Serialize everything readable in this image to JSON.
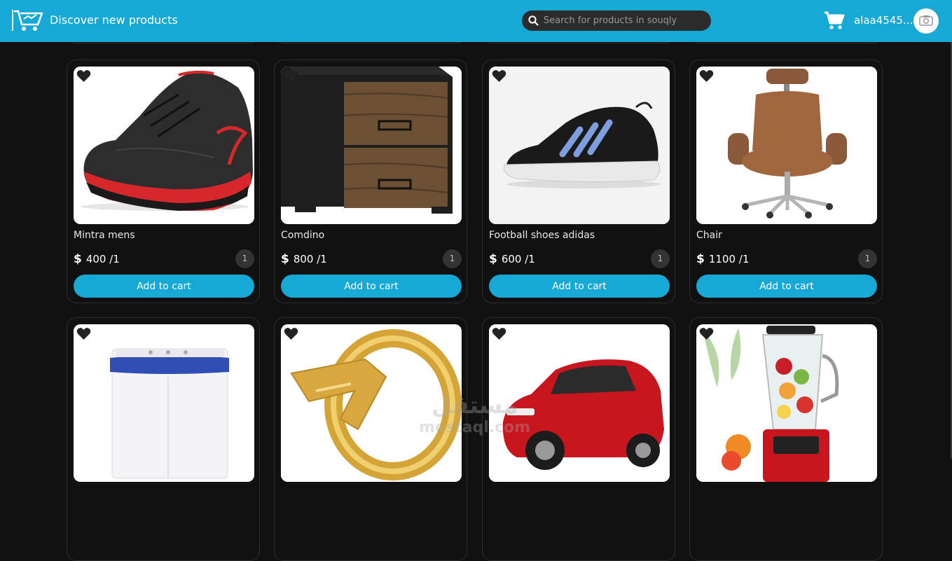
{
  "header": {
    "brand_title": "Discover new products",
    "search_placeholder": "Search for products in souqly",
    "username": "alaa4545...",
    "accent_color": "#17a9d6",
    "icons": [
      "cart-logo-icon",
      "search-icon",
      "shopping-cart-icon",
      "avatar-camera-icon"
    ]
  },
  "products": [
    {
      "name": "Mintra mens",
      "price": "400 /1",
      "quantity": "1",
      "button": "Add to cart"
    },
    {
      "name": "Comdino",
      "price": "800 /1",
      "quantity": "1",
      "button": "Add to cart"
    },
    {
      "name": "Football shoes adidas",
      "price": "600 /1",
      "quantity": "1",
      "button": "Add to cart"
    },
    {
      "name": "Chair",
      "price": "1100 /1",
      "quantity": "1",
      "button": "Add to cart"
    },
    {
      "name": "",
      "price": "",
      "quantity": "",
      "button": ""
    },
    {
      "name": "",
      "price": "",
      "quantity": "",
      "button": ""
    },
    {
      "name": "",
      "price": "",
      "quantity": "",
      "button": ""
    },
    {
      "name": "",
      "price": "",
      "quantity": "",
      "button": ""
    }
  ],
  "currency_symbol": "$",
  "watermark": {
    "arabic": "مستقل",
    "latin": "mostaql.com"
  }
}
